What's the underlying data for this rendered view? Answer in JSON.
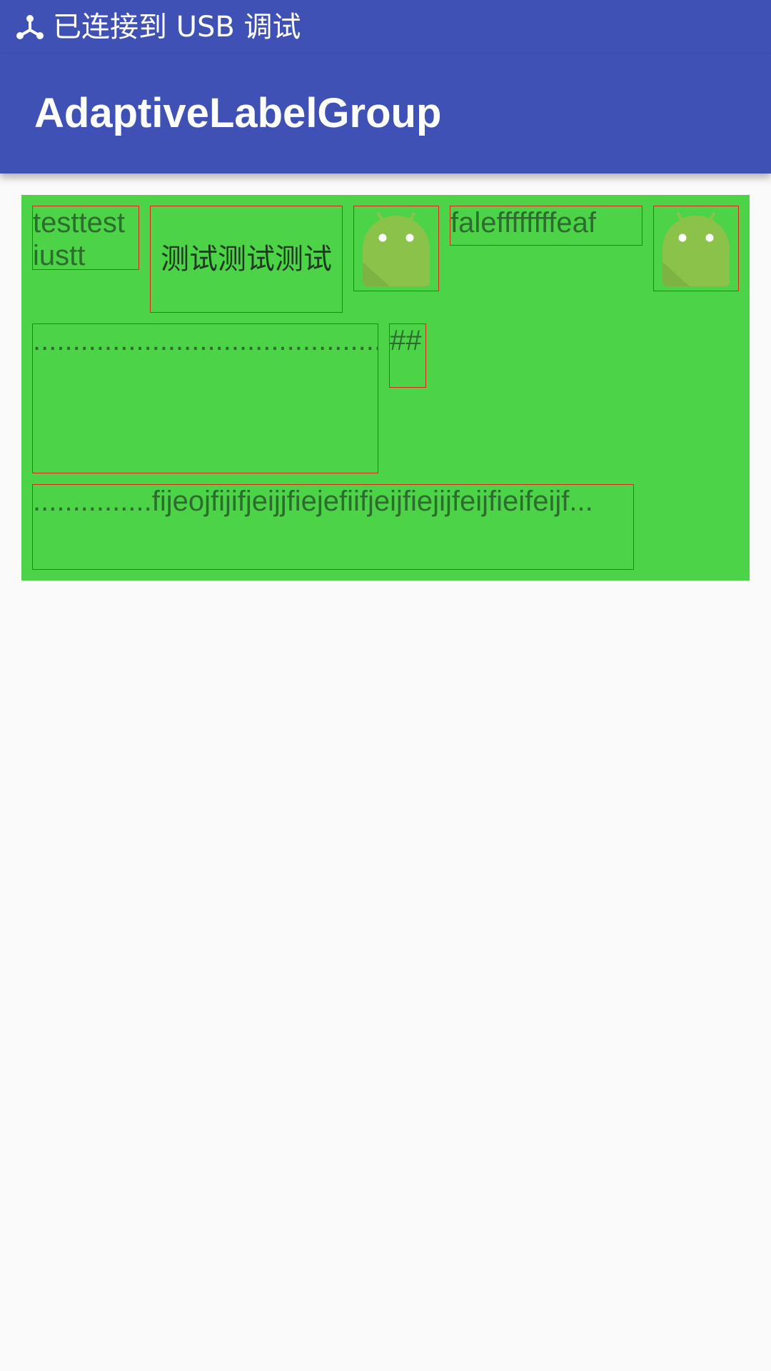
{
  "status_bar": {
    "icon": "usb-icon",
    "text": "已连接到 USB 调试"
  },
  "app_bar": {
    "title": "AdaptiveLabelGroup"
  },
  "label_group": {
    "background": "#4cd348",
    "border_color": "#e0251b",
    "labels": [
      "testtest iustt",
      "测试测试测试",
      "android-robot-icon",
      "faleffffffffeaf",
      "android-robot-icon",
      "...............................................",
      "##",
      "...............fijeojfijifjeijjfiejefiifjeijfiejijfeijfieifeijf..."
    ]
  }
}
